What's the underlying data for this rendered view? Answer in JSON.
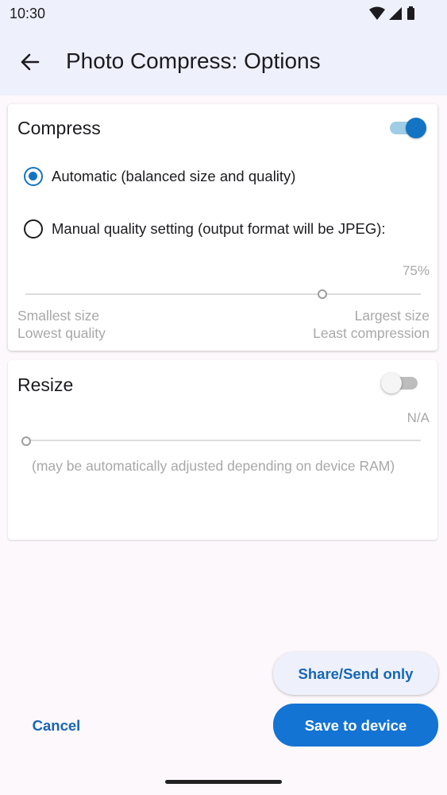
{
  "status_bar": {
    "time": "10:30",
    "icons": [
      "wifi-icon",
      "cellular-signal-icon",
      "battery-icon"
    ]
  },
  "app_bar": {
    "title": "Photo Compress: Options",
    "back_icon": "arrow-left-icon"
  },
  "compress": {
    "title": "Compress",
    "enabled": true,
    "options": [
      {
        "label": "Automatic (balanced size and quality)",
        "selected": true
      },
      {
        "label": "Manual quality setting (output format will be JPEG):",
        "selected": false
      }
    ],
    "quality_value": "75%",
    "quality_fraction": 0.75,
    "min_label_1": "Smallest size",
    "min_label_2": "Lowest quality",
    "max_label_1": "Largest size",
    "max_label_2": "Least compression"
  },
  "resize": {
    "title": "Resize",
    "enabled": false,
    "value": "N/A",
    "slider_fraction": 0,
    "note": "(may be automatically adjusted depending on device RAM)"
  },
  "actions": {
    "share_label": "Share/Send only",
    "save_label": "Save to device",
    "cancel_label": "Cancel"
  },
  "colors": {
    "accent": "#1474c4",
    "surface": "#eef0fb",
    "muted_text": "#a8a8a8"
  }
}
